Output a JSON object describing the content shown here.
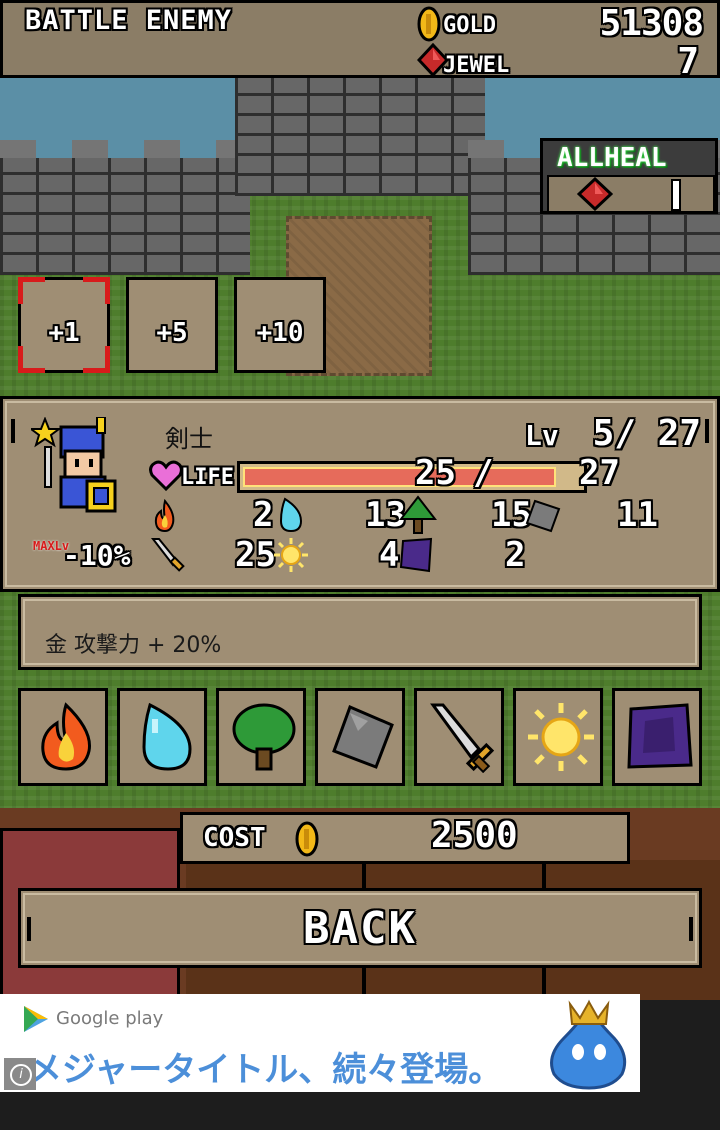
{
  "header": {
    "title": "BATTLE ENEMY",
    "gold_label": "GOLD",
    "gold_value": "51308",
    "jewel_label": "JEWEL",
    "jewel_value": "7"
  },
  "allheal": {
    "label": "ALLHEAL"
  },
  "level_up_buttons": [
    "+1",
    "+5",
    "+10"
  ],
  "character": {
    "name": "剣士",
    "lv_label": "Lv",
    "level": "5/ 27",
    "life_label": "LIFE",
    "life_current": "25",
    "life_max": "27",
    "life_fraction": 0.926,
    "maxlv_label": "MAXLv",
    "maxlv_value": "-10%",
    "stats_row1": {
      "fire": "2",
      "water": "13",
      "wood": "15",
      "stone": "11"
    },
    "stats_row2": {
      "sword": "25",
      "light": "4",
      "dark": "2"
    }
  },
  "description": "金 攻撃力 + 20%",
  "skills": [
    "fire-icon",
    "water-drop-icon",
    "tree-icon",
    "stone-icon",
    "sword-icon",
    "sun-icon",
    "dark-icon"
  ],
  "cost": {
    "label": "COST",
    "value": "2500"
  },
  "back_label": "BACK",
  "ad": {
    "brand": "Google play",
    "text": "メジャータイトル、続々登場。"
  },
  "colors": {
    "panel": "#9f8e74",
    "life_bar": "#e66b5b",
    "gold": "#f2b818",
    "jewel": "#c72a2a"
  }
}
